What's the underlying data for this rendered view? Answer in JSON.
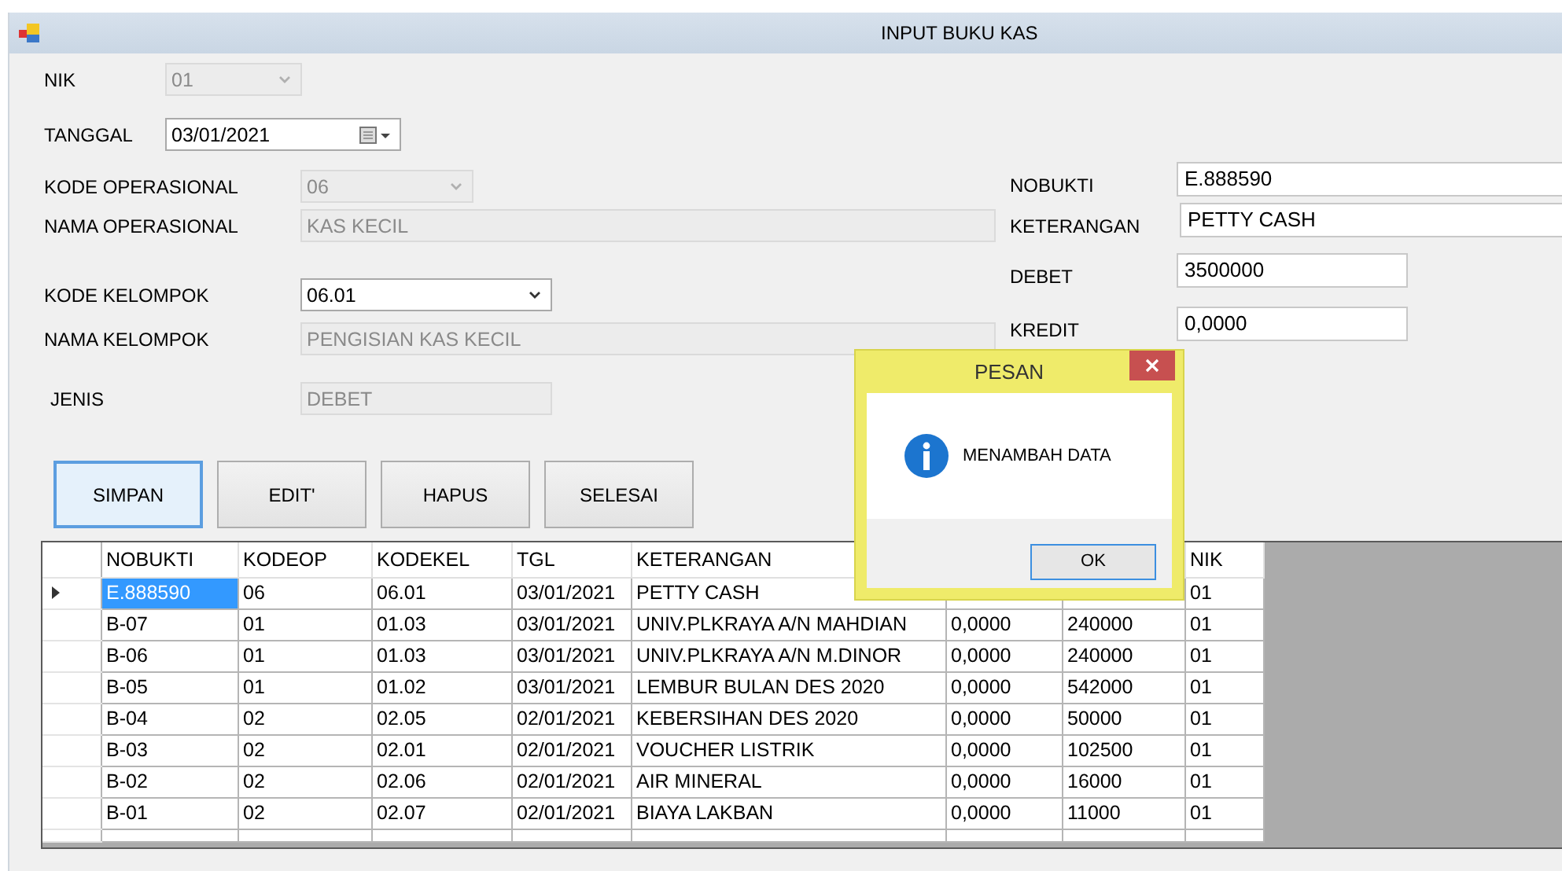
{
  "window": {
    "title": "INPUT BUKU KAS"
  },
  "form_left": [
    {
      "label": "NIK",
      "kind": "combo",
      "value": "01",
      "disabled": true
    },
    {
      "label": "TANGGAL",
      "kind": "date",
      "value": "03/01/2021",
      "disabled": false
    },
    {
      "label": "KODE OPERASIONAL",
      "kind": "combo",
      "value": "06",
      "disabled": true
    },
    {
      "label": "NAMA OPERASIONAL",
      "kind": "text",
      "value": "KAS KECIL",
      "disabled": true
    },
    {
      "label": "KODE KELOMPOK",
      "kind": "combo",
      "value": "06.01",
      "disabled": false
    },
    {
      "label": "NAMA KELOMPOK",
      "kind": "text",
      "value": "PENGISIAN KAS KECIL",
      "disabled": true
    },
    {
      "label": "JENIS",
      "kind": "text",
      "value": "DEBET",
      "disabled": true
    }
  ],
  "form_right": [
    {
      "label": "NOBUKTI",
      "value": "E.888590"
    },
    {
      "label": "KETERANGAN",
      "value": "PETTY CASH"
    },
    {
      "label": "DEBET",
      "value": "3500000"
    },
    {
      "label": "KREDIT",
      "value": "0,0000"
    }
  ],
  "buttons": [
    {
      "label": "SIMPAN",
      "focused": true
    },
    {
      "label": "EDIT'",
      "focused": false
    },
    {
      "label": "HAPUS",
      "focused": false
    },
    {
      "label": "SELESAI",
      "focused": false
    }
  ],
  "table": {
    "columns": [
      "NOBUKTI",
      "KODEOP",
      "KODEKEL",
      "TGL",
      "KETERANGAN",
      null,
      null,
      "NIK"
    ],
    "rows": [
      {
        "current": true,
        "selected": true,
        "cells": [
          "E.888590",
          "06",
          "06.01",
          "03/01/2021",
          "PETTY CASH",
          null,
          null,
          "01"
        ]
      },
      {
        "current": false,
        "selected": false,
        "cells": [
          "B-07",
          "01",
          "01.03",
          "03/01/2021",
          "UNIV.PLKRAYA A/N MAHDIAN",
          "0,0000",
          "240000",
          "01"
        ]
      },
      {
        "current": false,
        "selected": false,
        "cells": [
          "B-06",
          "01",
          "01.03",
          "03/01/2021",
          "UNIV.PLKRAYA A/N M.DINOR",
          "0,0000",
          "240000",
          "01"
        ]
      },
      {
        "current": false,
        "selected": false,
        "cells": [
          "B-05",
          "01",
          "01.02",
          "03/01/2021",
          "LEMBUR BULAN DES 2020",
          "0,0000",
          "542000",
          "01"
        ]
      },
      {
        "current": false,
        "selected": false,
        "cells": [
          "B-04",
          "02",
          "02.05",
          "02/01/2021",
          "KEBERSIHAN DES 2020",
          "0,0000",
          "50000",
          "01"
        ]
      },
      {
        "current": false,
        "selected": false,
        "cells": [
          "B-03",
          "02",
          "02.01",
          "02/01/2021",
          "VOUCHER LISTRIK",
          "0,0000",
          "102500",
          "01"
        ]
      },
      {
        "current": false,
        "selected": false,
        "cells": [
          "B-02",
          "02",
          "02.06",
          "02/01/2021",
          "AIR MINERAL",
          "0,0000",
          "16000",
          "01"
        ]
      },
      {
        "current": false,
        "selected": false,
        "cells": [
          "B-01",
          "02",
          "02.07",
          "02/01/2021",
          "BIAYA LAKBAN",
          "0,0000",
          "11000",
          "01"
        ]
      }
    ]
  },
  "dialog": {
    "title": "PESAN",
    "message": "MENAMBAH DATA",
    "button": "OK"
  }
}
